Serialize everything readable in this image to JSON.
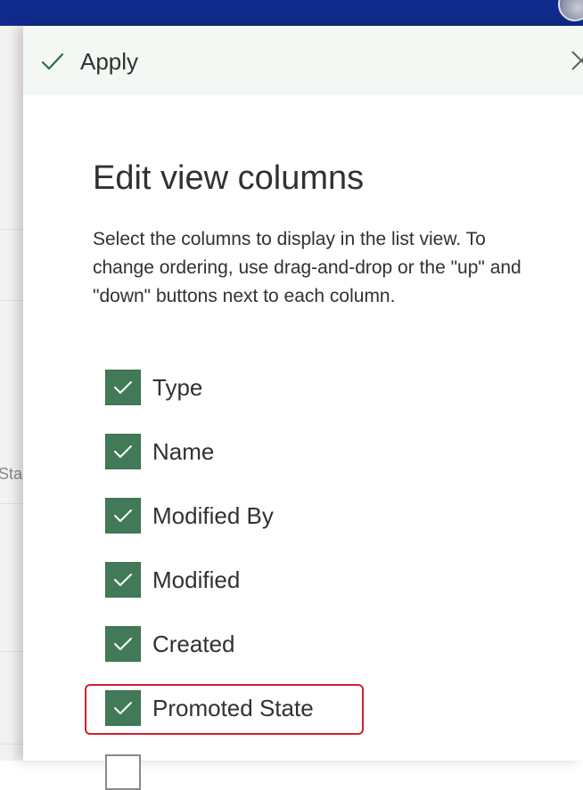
{
  "header": {
    "avatar_icon": "avatar-icon"
  },
  "background": {
    "partial_text": "Sta"
  },
  "panel": {
    "apply_label": "Apply",
    "apply_icon": "checkmark-icon",
    "close_icon": "close-icon",
    "title": "Edit view columns",
    "description": "Select the columns to display in the list view. To change ordering, use drag-and-drop or the \"up\" and \"down\" buttons next to each column.",
    "columns": [
      {
        "label": "Type",
        "checked": true
      },
      {
        "label": "Name",
        "checked": true
      },
      {
        "label": "Modified By",
        "checked": true
      },
      {
        "label": "Modified",
        "checked": true
      },
      {
        "label": "Created",
        "checked": true
      },
      {
        "label": "Promoted State",
        "checked": true,
        "highlighted": true
      },
      {
        "label": "",
        "checked": false
      }
    ]
  },
  "colors": {
    "topbar": "#0f2a8a",
    "checkbox_checked": "#427a57",
    "command_bar": "#f3f8f4",
    "highlight": "#d0202f"
  }
}
